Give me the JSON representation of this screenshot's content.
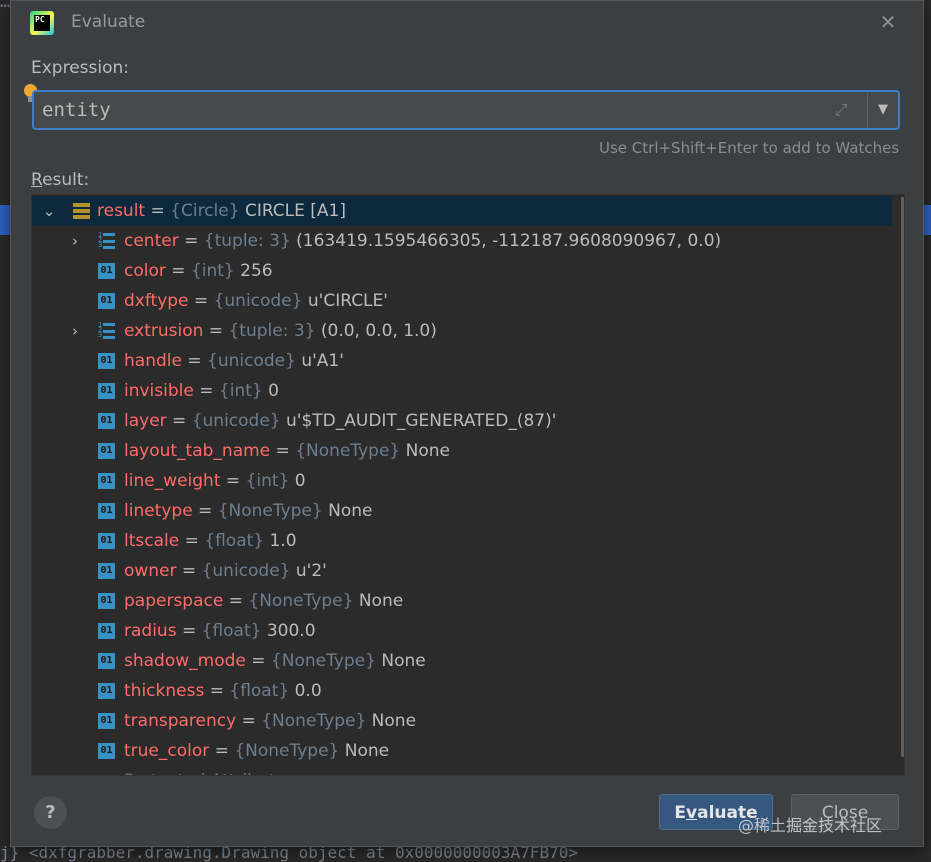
{
  "background": {
    "editor_top": "…",
    "editor_bottom": "j} <dxfgrabber.drawing.Drawing object at 0x0000000003A7FB70>"
  },
  "dialog": {
    "title": "Evaluate",
    "app_icon_label": "PC",
    "close_icon": "close-icon",
    "expression_label": "Expression:",
    "expression_value": "entity",
    "hint": "Use Ctrl+Shift+Enter to add to Watches",
    "result_label_u": "R",
    "result_label_rest": "esult:"
  },
  "tree": {
    "root": {
      "name": "result",
      "type": "{Circle}",
      "value": "CIRCLE [A1]"
    },
    "children": [
      {
        "name": "center",
        "type": "{tuple: 3}",
        "value": "(163419.1595466305, -112187.9608090967, 0.0)",
        "expandable": true,
        "icon": "list-icon"
      },
      {
        "name": "color",
        "type": "{int}",
        "value": "256",
        "expandable": false,
        "icon": "primitive-icon"
      },
      {
        "name": "dxftype",
        "type": "{unicode}",
        "value": "u'CIRCLE'",
        "expandable": false,
        "icon": "primitive-icon"
      },
      {
        "name": "extrusion",
        "type": "{tuple: 3}",
        "value": "(0.0, 0.0, 1.0)",
        "expandable": true,
        "icon": "list-icon"
      },
      {
        "name": "handle",
        "type": "{unicode}",
        "value": "u'A1'",
        "expandable": false,
        "icon": "primitive-icon"
      },
      {
        "name": "invisible",
        "type": "{int}",
        "value": "0",
        "expandable": false,
        "icon": "primitive-icon"
      },
      {
        "name": "layer",
        "type": "{unicode}",
        "value": "u'$TD_AUDIT_GENERATED_(87)'",
        "expandable": false,
        "icon": "primitive-icon"
      },
      {
        "name": "layout_tab_name",
        "type": "{NoneType}",
        "value": "None",
        "expandable": false,
        "icon": "primitive-icon"
      },
      {
        "name": "line_weight",
        "type": "{int}",
        "value": "0",
        "expandable": false,
        "icon": "primitive-icon"
      },
      {
        "name": "linetype",
        "type": "{NoneType}",
        "value": "None",
        "expandable": false,
        "icon": "primitive-icon"
      },
      {
        "name": "ltscale",
        "type": "{float}",
        "value": "1.0",
        "expandable": false,
        "icon": "primitive-icon"
      },
      {
        "name": "owner",
        "type": "{unicode}",
        "value": "u'2'",
        "expandable": false,
        "icon": "primitive-icon"
      },
      {
        "name": "paperspace",
        "type": "{NoneType}",
        "value": "None",
        "expandable": false,
        "icon": "primitive-icon"
      },
      {
        "name": "radius",
        "type": "{float}",
        "value": "300.0",
        "expandable": false,
        "icon": "primitive-icon"
      },
      {
        "name": "shadow_mode",
        "type": "{NoneType}",
        "value": "None",
        "expandable": false,
        "icon": "primitive-icon"
      },
      {
        "name": "thickness",
        "type": "{float}",
        "value": "0.0",
        "expandable": false,
        "icon": "primitive-icon"
      },
      {
        "name": "transparency",
        "type": "{NoneType}",
        "value": "None",
        "expandable": false,
        "icon": "primitive-icon"
      },
      {
        "name": "true_color",
        "type": "{NoneType}",
        "value": "None",
        "expandable": false,
        "icon": "primitive-icon"
      }
    ],
    "partial_row": "Protected Attributes"
  },
  "buttons": {
    "help": "?",
    "evaluate_prefix": "E",
    "evaluate_mnemonic": "v",
    "evaluate_rest": "aluate",
    "close": "Close"
  },
  "watermark": "@稀土掘金技术社区",
  "colors": {
    "dialog_bg": "#3c3f41",
    "tree_bg": "#2b2b2b",
    "selection": "#0d293e",
    "focus_border": "#3d7ec9",
    "name_color": "#ff6b68",
    "type_color": "#6d7e8e",
    "primary_button": "#365880"
  }
}
